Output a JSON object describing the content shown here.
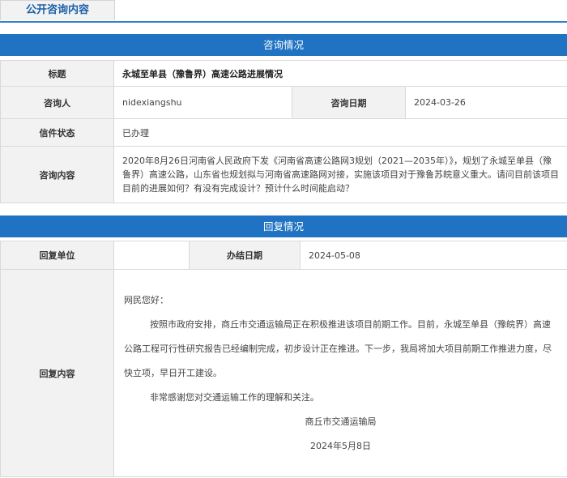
{
  "tab": {
    "label": "公开咨询内容"
  },
  "consult_section": {
    "title": "咨询情况"
  },
  "consult": {
    "title_label": "标题",
    "title_value": "永城至单县（豫鲁界）高速公路进展情况",
    "person_label": "咨询人",
    "person_value": "nidexiangshu",
    "date_label": "咨询日期",
    "date_value": "2024-03-26",
    "status_label": "信件状态",
    "status_value": "已办理",
    "content_label": "咨询内容",
    "content_value": "2020年8月26日河南省人民政府下发《河南省高速公路网3规划（2021—2035年）》，规划了永城至单县（豫鲁界）高速公路，山东省也规划拟与河南省高速路网对接，实施该项目对于豫鲁苏皖意义重大。请问目前该项目目前的进展如何？有没有完成设计？预计什么时间能启动？"
  },
  "reply_section": {
    "title": "回复情况"
  },
  "reply": {
    "unit_label": "回复单位",
    "unit_value": "",
    "date_label": "办结日期",
    "date_value": "2024-05-08",
    "content_label": "回复内容",
    "greeting": "网民您好：",
    "paragraph1": "按照市政府安排，商丘市交通运输局正在积极推进该项目前期工作。目前，永城至单县（豫皖界）高速公路工程可行性研究报告已经编制完成，初步设计正在推进。下一步，我局将加大项目前期工作推进力度，尽快立项，早日开工建设。",
    "paragraph2": "非常感谢您对交通运输工作的理解和关注。",
    "signature": "商丘市交通运输局",
    "sign_date": "2024年5月8日"
  },
  "colors": {
    "accent": "#1f73c2",
    "label_bg": "#f2f2f2",
    "border": "#d9d9d9"
  }
}
